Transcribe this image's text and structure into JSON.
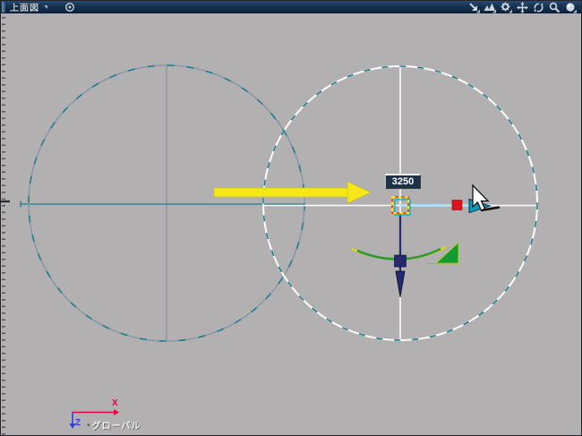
{
  "titlebar": {
    "view_label": "上面図",
    "bg_top": "#2a4a72",
    "bg_bottom": "#0e2440",
    "icons": [
      {
        "name": "view-menu-dropdown-icon"
      },
      {
        "name": "target-icon"
      },
      {
        "name": "pointer-tool-icon",
        "has_dropdown": true
      },
      {
        "name": "display-mode-icon",
        "has_dropdown": true
      },
      {
        "name": "settings-gear-icon",
        "has_dropdown": true
      },
      {
        "name": "pan-icon"
      },
      {
        "name": "orbit-icon"
      },
      {
        "name": "zoom-icon"
      },
      {
        "name": "sphere-view-icon",
        "has_dropdown": true
      }
    ]
  },
  "viewport": {
    "background": "#b2b0b0",
    "dimension_value": "3250",
    "circles": [
      {
        "name": "source-circle",
        "stroke": "#8b98a6",
        "dash_color": "#1f7e92"
      },
      {
        "name": "target-circle",
        "stroke": "#ffffff",
        "dash_color": "#1d7b8e"
      }
    ],
    "annotation_arrow_color": "#f6e71a",
    "manipulator": {
      "center_square_color": "#ef5010",
      "center_dash_color": "#ffe80a",
      "select_frame_color": "#00bcd8",
      "axis_line_color": "#b5dff0",
      "move_handle_color": "#e0101c",
      "direction_arrow_color": "#00a0c4",
      "z_axis_color": "#252a70",
      "rotate_arc_color": "#2b9b36",
      "scale_handle_color": "#129a33"
    },
    "axis_indicator": {
      "x_label": "X",
      "z_label": "Z",
      "space_label": "グローバル",
      "x_color": "#ea0048",
      "z_color": "#3040dd"
    }
  }
}
